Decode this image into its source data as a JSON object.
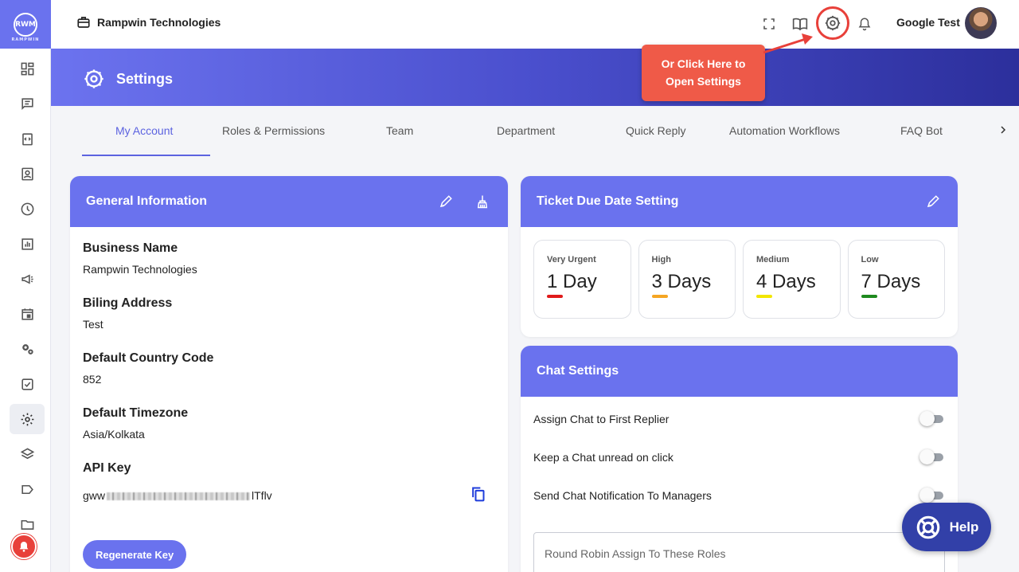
{
  "app": {
    "logo_text": "RWM",
    "logo_sub": "RAMPWIN"
  },
  "topbar": {
    "company_name": "Rampwin Technologies",
    "user_name": "Google Test"
  },
  "header": {
    "title": "Settings"
  },
  "callout": {
    "line1": "Or Click Here to",
    "line2": "Open Settings"
  },
  "tabs": [
    {
      "label": "My Account",
      "active": true
    },
    {
      "label": "Roles & Permissions"
    },
    {
      "label": "Team"
    },
    {
      "label": "Department"
    },
    {
      "label": "Quick Reply"
    },
    {
      "label": "Automation Workflows"
    },
    {
      "label": "FAQ Bot"
    }
  ],
  "general": {
    "title": "General Information",
    "fields": [
      {
        "label": "Business Name",
        "value": "Rampwin Technologies"
      },
      {
        "label": "Biling Address",
        "value": "Test"
      },
      {
        "label": "Default Country Code",
        "value": "852"
      },
      {
        "label": "Default Timezone",
        "value": "Asia/Kolkata"
      }
    ],
    "api_label": "API Key",
    "api_prefix": "gww",
    "api_suffix": "lTflv",
    "regen_label": "Regenerate Key"
  },
  "due": {
    "title": "Ticket Due Date Setting",
    "levels": [
      {
        "label": "Very Urgent",
        "value": "1 Day",
        "color": "#e01b1b"
      },
      {
        "label": "High",
        "value": "3 Days",
        "color": "#f5a623"
      },
      {
        "label": "Medium",
        "value": "4 Days",
        "color": "#f2e600"
      },
      {
        "label": "Low",
        "value": "7 Days",
        "color": "#1e8a1e"
      }
    ]
  },
  "chat": {
    "title": "Chat Settings",
    "toggles": [
      {
        "label": "Assign Chat to First Replier",
        "on": false
      },
      {
        "label": "Keep a Chat unread on click",
        "on": false
      },
      {
        "label": "Send Chat Notification To Managers",
        "on": false
      }
    ],
    "round_robin_placeholder": "Round Robin Assign To These Roles"
  },
  "help": {
    "label": "Help"
  },
  "colors": {
    "primary": "#6a72ee",
    "accent_red": "#e8403a",
    "help_bg": "#3240a8"
  }
}
